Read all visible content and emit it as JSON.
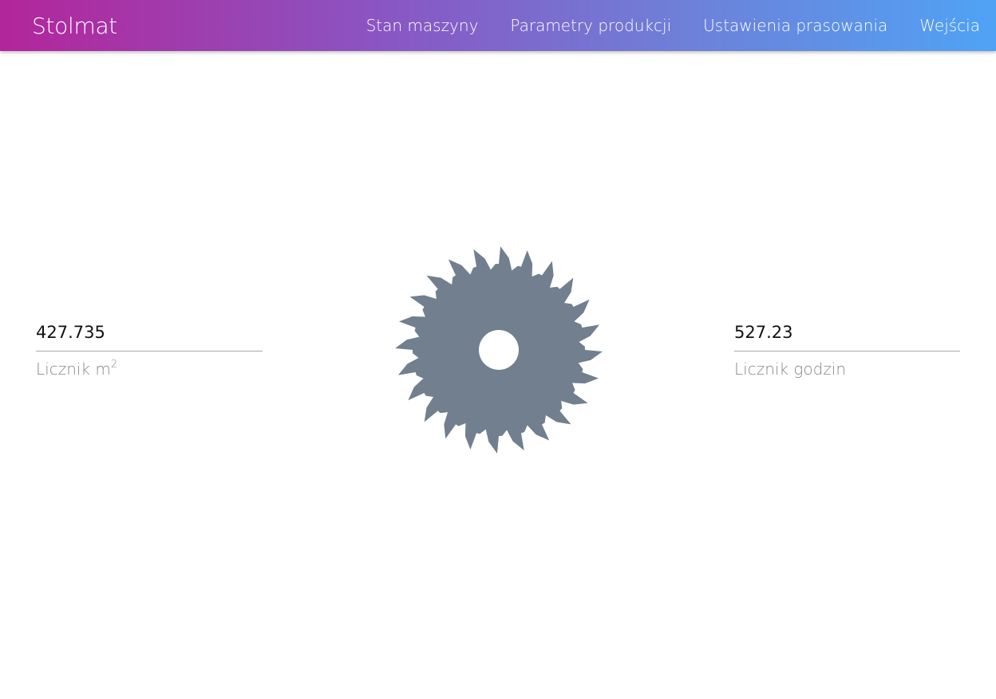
{
  "header": {
    "brand": "Stolmat",
    "gradient": [
      "#b3259a",
      "#4fa3f5"
    ],
    "nav": [
      {
        "label": "Stan maszyny"
      },
      {
        "label": "Parametry produkcji"
      },
      {
        "label": "Ustawienia prasowania"
      },
      {
        "label": "Wejścia"
      }
    ]
  },
  "main": {
    "icon": "circular-saw-blade-icon",
    "icon_color": "#717f8f",
    "counter_m2": {
      "value": "427.735",
      "label": "Licznik m",
      "label_sup": "2"
    },
    "counter_hours": {
      "value": "527.23",
      "label": "Licznik godzin"
    }
  }
}
